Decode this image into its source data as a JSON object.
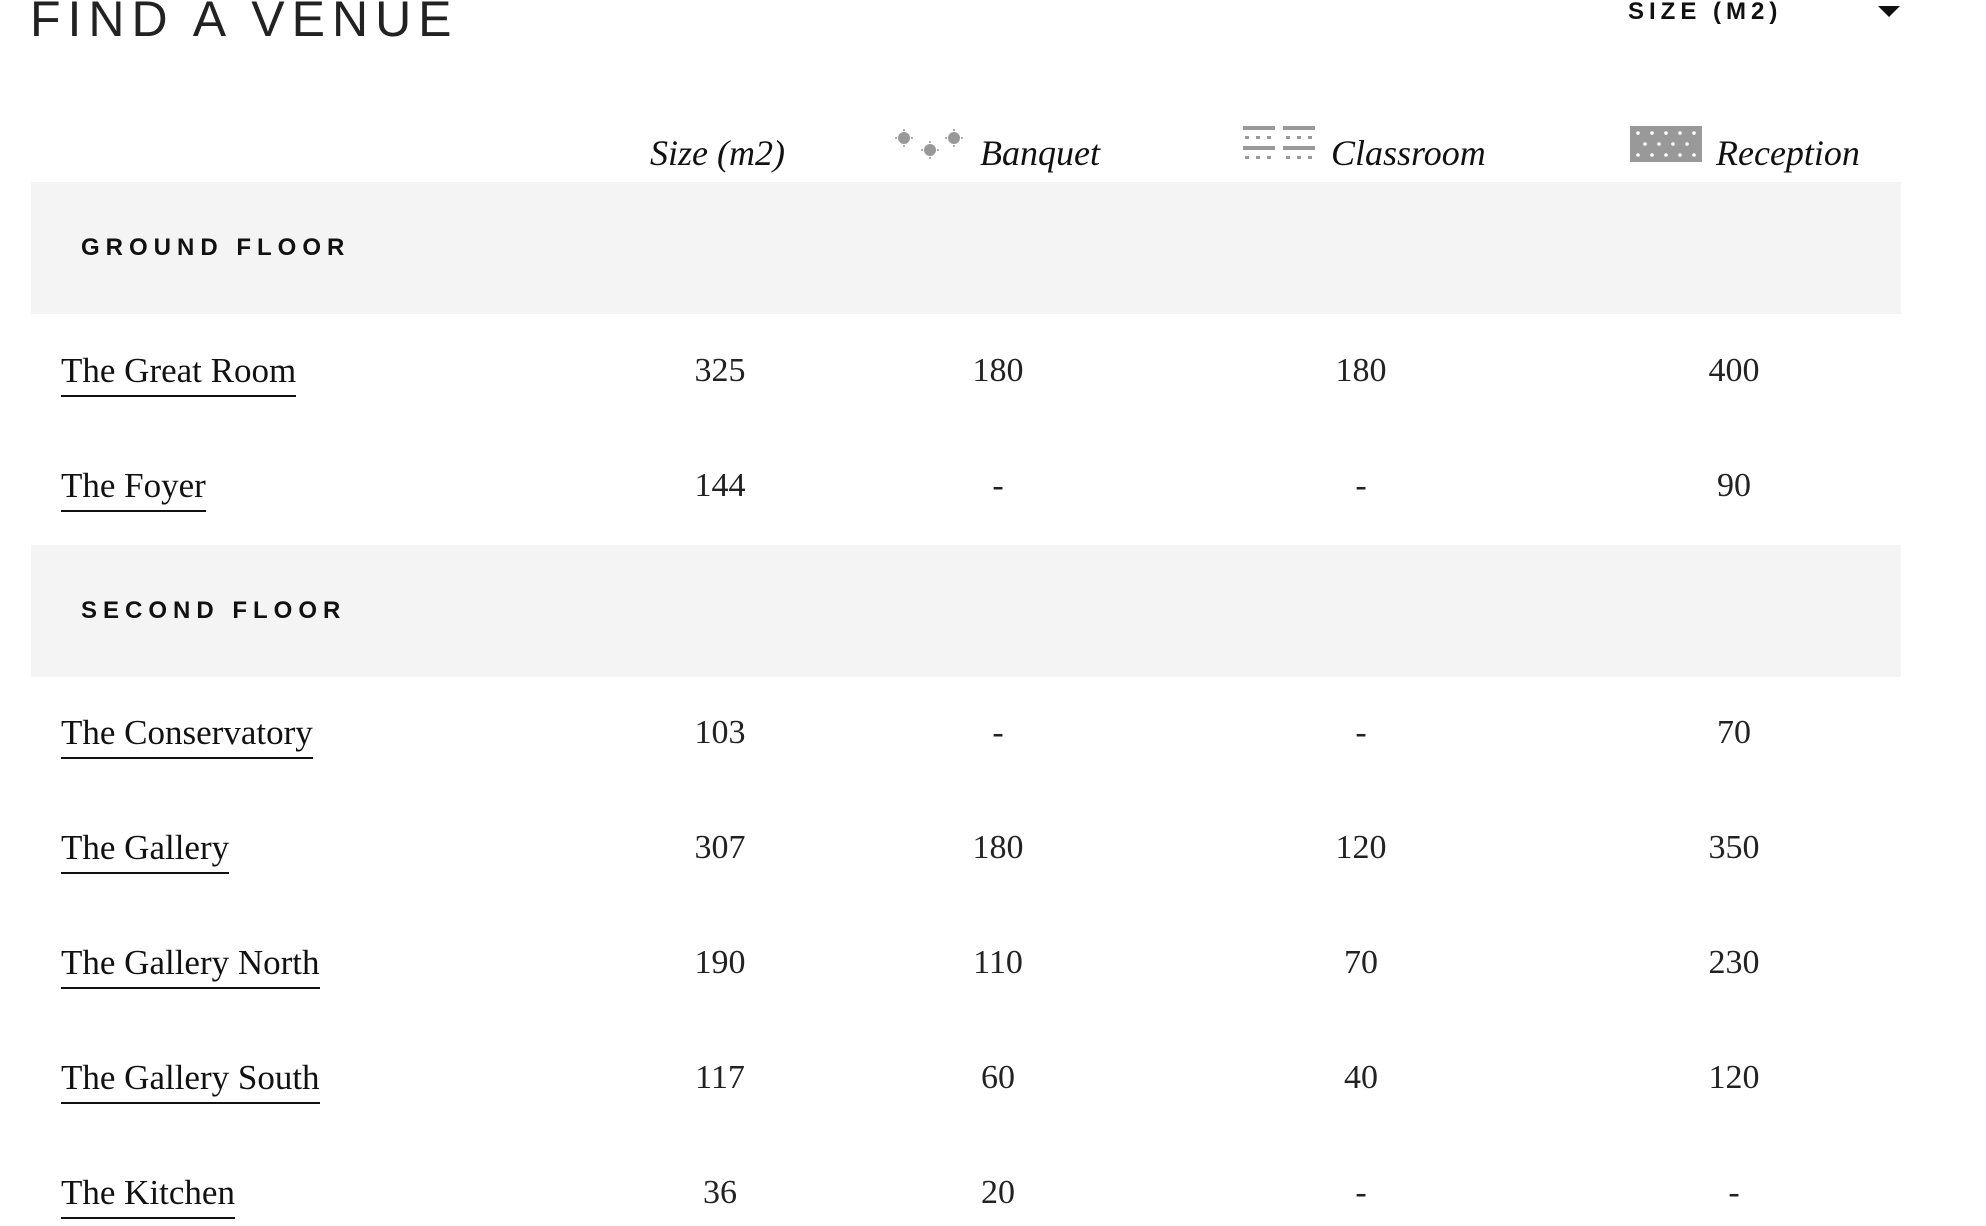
{
  "page": {
    "title": "FIND A VENUE"
  },
  "sort": {
    "selected": "SIZE (M2)",
    "icon": "chevron-down-icon"
  },
  "columns": {
    "size": "Size (m2)",
    "banquet": "Banquet",
    "classroom": "Classroom",
    "reception": "Reception",
    "banquet_icon": "banquet-layout-icon",
    "classroom_icon": "classroom-layout-icon",
    "reception_icon": "reception-layout-icon"
  },
  "colors": {
    "band": "#f4f4f4",
    "icon": "#999999",
    "text": "#111111"
  },
  "sections": [
    {
      "label": "GROUND FLOOR",
      "rooms": [
        {
          "name": "The Great Room",
          "size": "325",
          "banquet": "180",
          "classroom": "180",
          "reception": "400"
        },
        {
          "name": "The Foyer",
          "size": "144",
          "banquet": "-",
          "classroom": "-",
          "reception": "90"
        }
      ]
    },
    {
      "label": "SECOND FLOOR",
      "rooms": [
        {
          "name": "The Conservatory",
          "size": "103",
          "banquet": "-",
          "classroom": "-",
          "reception": "70"
        },
        {
          "name": "The Gallery",
          "size": "307",
          "banquet": "180",
          "classroom": "120",
          "reception": "350"
        },
        {
          "name": "The Gallery North",
          "size": "190",
          "banquet": "110",
          "classroom": "70",
          "reception": "230"
        },
        {
          "name": "The Gallery South",
          "size": "117",
          "banquet": "60",
          "classroom": "40",
          "reception": "120"
        },
        {
          "name": "The Kitchen",
          "size": "36",
          "banquet": "20",
          "classroom": "-",
          "reception": "-"
        }
      ]
    }
  ]
}
